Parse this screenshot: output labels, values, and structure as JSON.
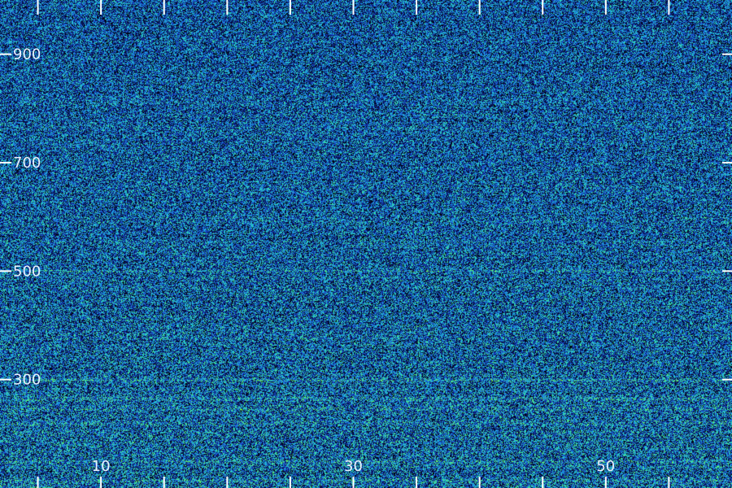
{
  "chart_data": {
    "type": "heatmap",
    "title": "",
    "xlabel": "",
    "ylabel": "",
    "xlim": [
      2,
      60
    ],
    "ylim": [
      100,
      1000
    ],
    "x_ticks": [
      {
        "value": 5,
        "label": ""
      },
      {
        "value": 10,
        "label": "10"
      },
      {
        "value": 15,
        "label": ""
      },
      {
        "value": 20,
        "label": ""
      },
      {
        "value": 25,
        "label": ""
      },
      {
        "value": 30,
        "label": "30"
      },
      {
        "value": 35,
        "label": ""
      },
      {
        "value": 40,
        "label": ""
      },
      {
        "value": 45,
        "label": ""
      },
      {
        "value": 50,
        "label": "50"
      },
      {
        "value": 55,
        "label": ""
      }
    ],
    "y_ticks": [
      {
        "value": 900,
        "label": "900"
      },
      {
        "value": 700,
        "label": "700"
      },
      {
        "value": 500,
        "label": "500"
      },
      {
        "value": 300,
        "label": "300"
      }
    ],
    "highlight_rows": [
      500,
      300,
      265,
      245,
      220,
      150,
      115
    ],
    "grid": false,
    "colormap": [
      "#000000",
      "#0a1a6e",
      "#1e4fd8",
      "#19b4e6",
      "#3de0a0",
      "#7cff3a"
    ],
    "colors": {
      "background": "#000010",
      "tick": "#ffffff",
      "label": "#e8f0ff"
    }
  }
}
